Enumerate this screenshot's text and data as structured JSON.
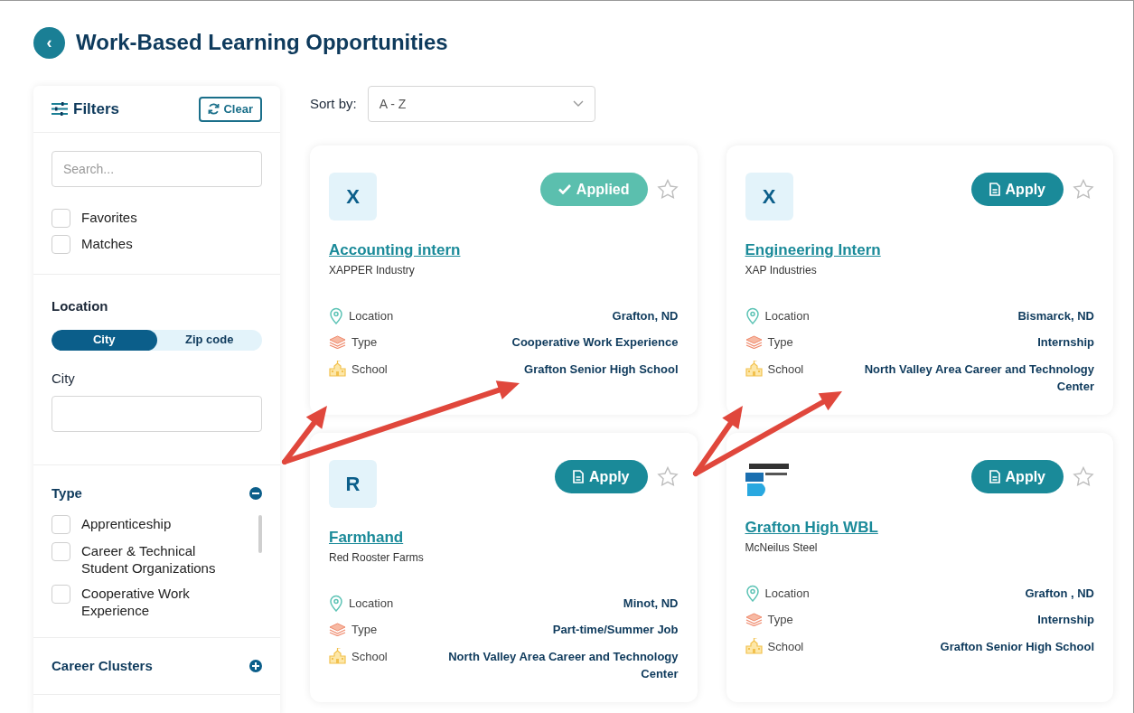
{
  "header": {
    "back_icon": "‹",
    "title": "Work-Based Learning Opportunities"
  },
  "filters": {
    "title": "Filters",
    "clear_button": "Clear",
    "search": {
      "placeholder": "Search..."
    },
    "quick": [
      {
        "label": "Favorites",
        "checked": false
      },
      {
        "label": "Matches",
        "checked": false
      }
    ],
    "location": {
      "title": "Location",
      "modes": [
        {
          "label": "City",
          "selected": true
        },
        {
          "label": "Zip code",
          "selected": false
        }
      ],
      "city_label": "City"
    },
    "sections": [
      {
        "title": "Type",
        "expanded": true,
        "options": [
          {
            "label": "Apprenticeship",
            "checked": false
          },
          {
            "label": "Career & Technical Student Organizations",
            "checked": false
          },
          {
            "label": "Cooperative Work Experience",
            "checked": false
          }
        ]
      },
      {
        "title": "Career Clusters",
        "expanded": false
      }
    ]
  },
  "sort": {
    "label": "Sort by:",
    "value": "A - Z"
  },
  "cards": [
    {
      "logo": {
        "kind": "letter",
        "text": "X"
      },
      "applied": true,
      "button": "Applied",
      "favorite": false,
      "title": "Accounting intern",
      "company": "XAPPER Industry",
      "fields": [
        {
          "kind": "location",
          "label": "Location",
          "value": "Grafton, ND"
        },
        {
          "kind": "type",
          "label": "Type",
          "value": "Cooperative Work Experience"
        },
        {
          "kind": "school",
          "label": "School",
          "value": "Grafton Senior High School"
        }
      ]
    },
    {
      "logo": {
        "kind": "letter",
        "text": "X"
      },
      "applied": false,
      "button": "Apply",
      "favorite": false,
      "title": "Engineering Intern",
      "company": "XAP Industries",
      "fields": [
        {
          "kind": "location",
          "label": "Location",
          "value": "Bismarck, ND"
        },
        {
          "kind": "type",
          "label": "Type",
          "value": "Internship"
        },
        {
          "kind": "school",
          "label": "School",
          "value": "North Valley Area Career and Technology Center"
        }
      ]
    },
    {
      "logo": {
        "kind": "letter",
        "text": "R"
      },
      "applied": false,
      "button": "Apply",
      "favorite": false,
      "title": "Farmhand",
      "company": "Red Rooster Farms",
      "fields": [
        {
          "kind": "location",
          "label": "Location",
          "value": "Minot, ND"
        },
        {
          "kind": "type",
          "label": "Type",
          "value": "Part-time/Summer Job"
        },
        {
          "kind": "school",
          "label": "School",
          "value": "North Valley Area Career and Technology Center"
        }
      ]
    },
    {
      "logo": {
        "kind": "image"
      },
      "applied": false,
      "button": "Apply",
      "favorite": false,
      "title": "Grafton High WBL",
      "company": "McNeilus Steel",
      "fields": [
        {
          "kind": "location",
          "label": "Location",
          "value": "Grafton , ND"
        },
        {
          "kind": "type",
          "label": "Type",
          "value": "Internship"
        },
        {
          "kind": "school",
          "label": "School",
          "value": "Grafton Senior High School"
        }
      ]
    }
  ]
}
